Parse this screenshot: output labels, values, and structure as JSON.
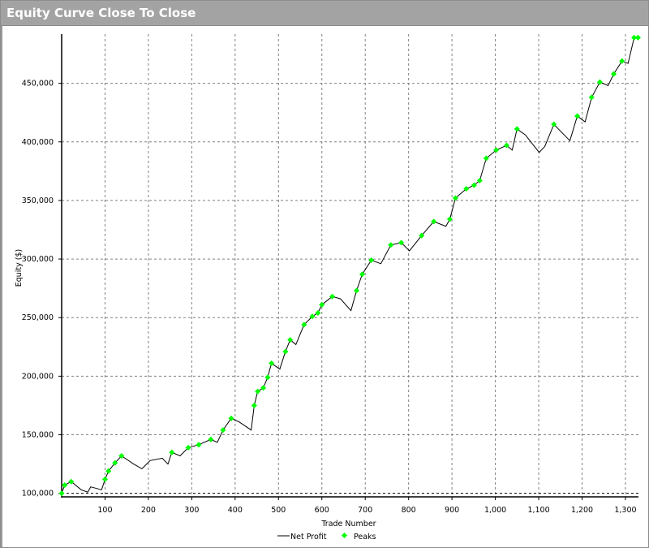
{
  "window": {
    "title": "Equity Curve Close To Close"
  },
  "chart_data": {
    "type": "line",
    "title": "Equity Curve Close To Close",
    "xlabel": "Trade Number",
    "ylabel": "Equity ($)",
    "xlim": [
      0,
      1330
    ],
    "ylim": [
      97000,
      492000
    ],
    "x_ticks": [
      100,
      200,
      300,
      400,
      500,
      600,
      700,
      800,
      900,
      1000,
      1100,
      1200,
      1300
    ],
    "x_tick_labels": [
      "100",
      "200",
      "300",
      "400",
      "500",
      "600",
      "700",
      "800",
      "900",
      "1,000",
      "1,100",
      "1,200",
      "1,300"
    ],
    "y_ticks": [
      100000,
      150000,
      200000,
      250000,
      300000,
      350000,
      400000,
      450000
    ],
    "y_tick_labels": [
      "100,000",
      "150,000",
      "200,000",
      "250,000",
      "300,000",
      "350,000",
      "400,000",
      "450,000"
    ],
    "grid": true,
    "legend": {
      "position": "bottom-center",
      "entries": [
        "Net Profit",
        "Peaks"
      ]
    },
    "colors": {
      "net_profit": "#000000",
      "peaks": "#00ff00",
      "grid": "#808080"
    },
    "series": [
      {
        "name": "Net Profit",
        "x": [
          0,
          7,
          22,
          45,
          60,
          67,
          92,
          100,
          108,
          123,
          138,
          166,
          185,
          204,
          232,
          245,
          254,
          273,
          292,
          316,
          344,
          359,
          372,
          391,
          409,
          437,
          444,
          452,
          465,
          475,
          484,
          503,
          516,
          527,
          540,
          559,
          578,
          591,
          600,
          624,
          643,
          667,
          680,
          693,
          714,
          736,
          759,
          783,
          802,
          830,
          858,
          886,
          895,
          908,
          933,
          951,
          964,
          979,
          1002,
          1026,
          1039,
          1050,
          1069,
          1101,
          1114,
          1135,
          1148,
          1172,
          1189,
          1207,
          1222,
          1241,
          1260,
          1273,
          1292,
          1306,
          1320,
          1329
        ],
        "y": [
          100000,
          107000,
          110000,
          103000,
          101000,
          105500,
          103000,
          112000,
          119000,
          126000,
          132000,
          125000,
          121000,
          128000,
          130000,
          125000,
          135000,
          132000,
          139000,
          141500,
          146000,
          143600,
          154000,
          164000,
          161000,
          154000,
          175000,
          187000,
          190000,
          199000,
          211000,
          206000,
          221000,
          231000,
          227000,
          244000,
          251000,
          254000,
          261000,
          268000,
          266000,
          256000,
          273000,
          287000,
          299000,
          296000,
          312000,
          314000,
          307000,
          320000,
          332000,
          328000,
          334000,
          352000,
          360000,
          363000,
          367000,
          386000,
          393000,
          397000,
          393000,
          411000,
          406000,
          391000,
          396000,
          415000,
          410000,
          401000,
          422000,
          417000,
          438000,
          451000,
          448000,
          458000,
          469000,
          467000,
          489000,
          489000
        ]
      }
    ]
  }
}
